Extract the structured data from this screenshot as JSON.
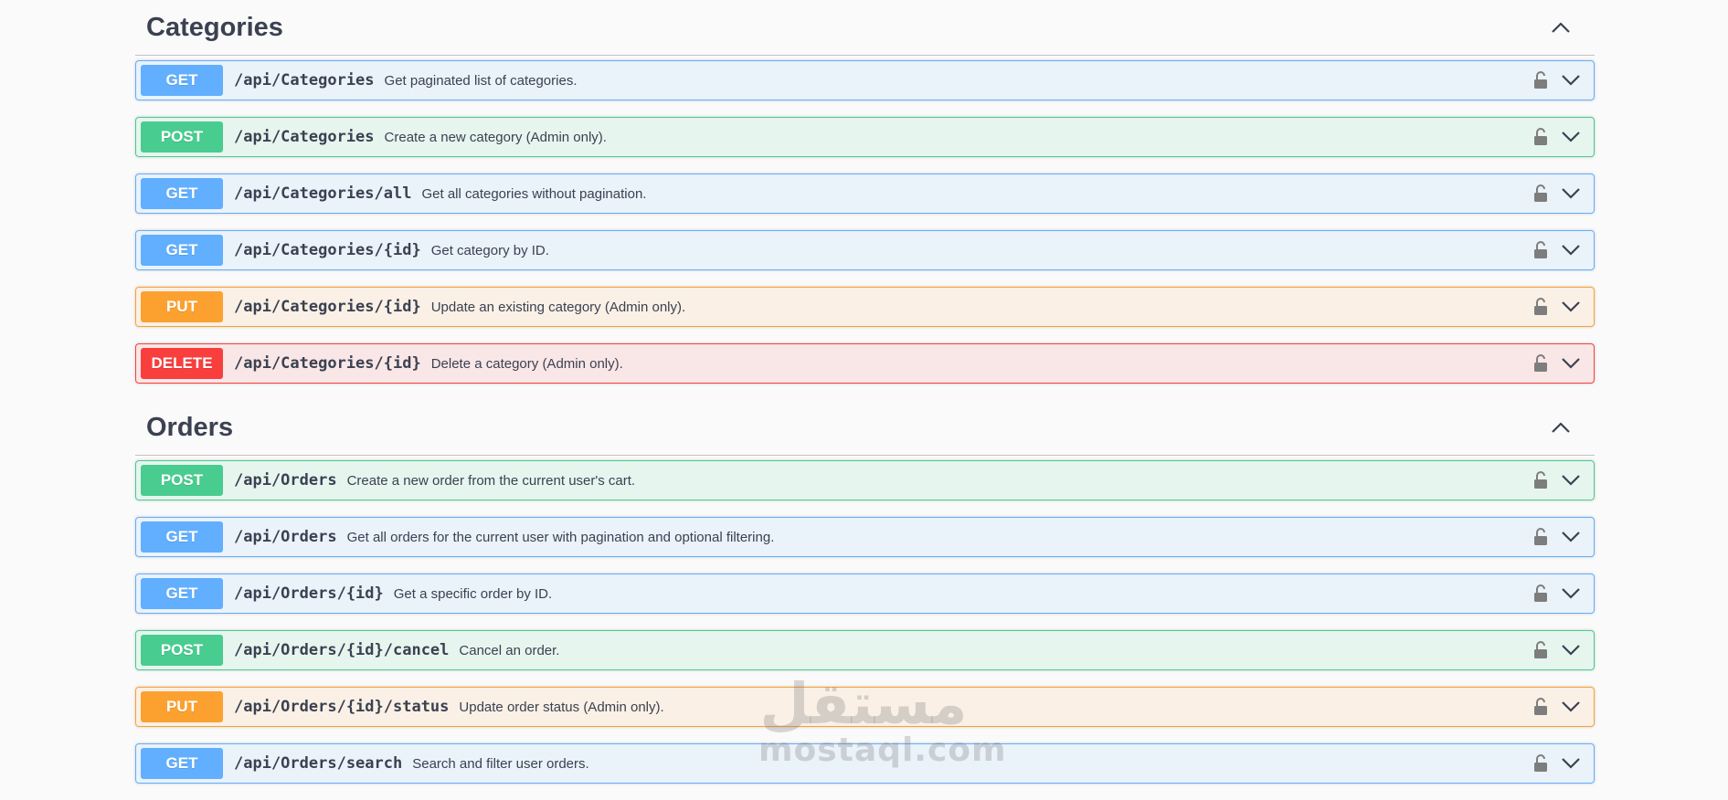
{
  "sections": [
    {
      "title": "Categories",
      "operations": [
        {
          "method": "GET",
          "path": "/api/Categories",
          "summary": "Get paginated list of categories."
        },
        {
          "method": "POST",
          "path": "/api/Categories",
          "summary": "Create a new category (Admin only)."
        },
        {
          "method": "GET",
          "path": "/api/Categories/all",
          "summary": "Get all categories without pagination."
        },
        {
          "method": "GET",
          "path": "/api/Categories/{id}",
          "summary": "Get category by ID."
        },
        {
          "method": "PUT",
          "path": "/api/Categories/{id}",
          "summary": "Update an existing category (Admin only)."
        },
        {
          "method": "DELETE",
          "path": "/api/Categories/{id}",
          "summary": "Delete a category (Admin only)."
        }
      ]
    },
    {
      "title": "Orders",
      "operations": [
        {
          "method": "POST",
          "path": "/api/Orders",
          "summary": "Create a new order from the current user's cart."
        },
        {
          "method": "GET",
          "path": "/api/Orders",
          "summary": "Get all orders for the current user with pagination and optional filtering."
        },
        {
          "method": "GET",
          "path": "/api/Orders/{id}",
          "summary": "Get a specific order by ID."
        },
        {
          "method": "POST",
          "path": "/api/Orders/{id}/cancel",
          "summary": "Cancel an order."
        },
        {
          "method": "PUT",
          "path": "/api/Orders/{id}/status",
          "summary": "Update order status (Admin only)."
        },
        {
          "method": "GET",
          "path": "/api/Orders/search",
          "summary": "Search and filter user orders."
        }
      ]
    }
  ],
  "icons": {
    "lock": "lock-icon",
    "expand": "chevron-down-icon",
    "collapse": "chevron-up-icon"
  },
  "colors": {
    "get": "#61affe",
    "post": "#49cc90",
    "put": "#fca130",
    "delete": "#f93e3e",
    "text": "#3b4151"
  },
  "watermark": {
    "arabic": "مستقل",
    "latin": "mostaql.com"
  }
}
